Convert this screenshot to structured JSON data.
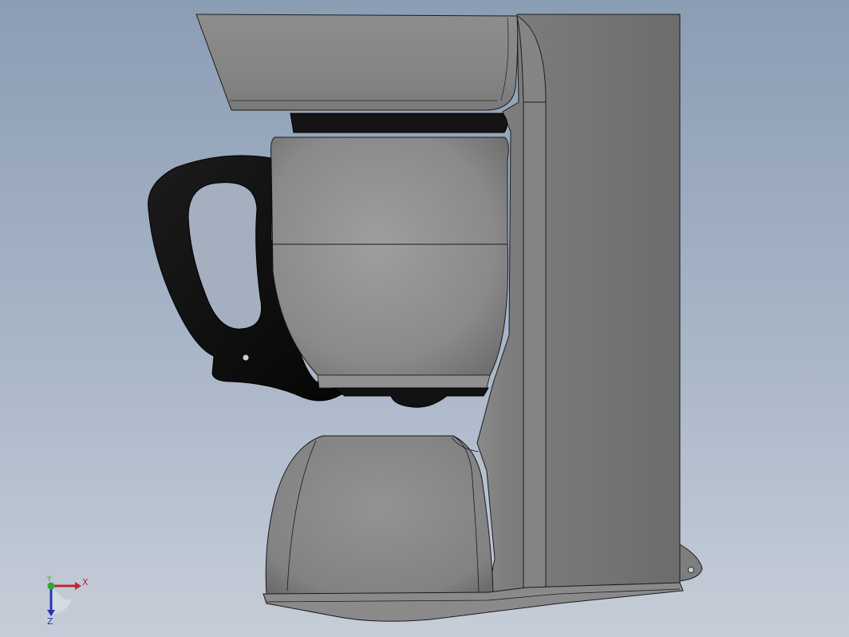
{
  "view": {
    "background_top": "#8b9db4",
    "background_bottom": "#c6cdd8"
  },
  "model": {
    "body_color": "#7c7c7c",
    "handle_color": "#0e0e0e",
    "edge_color": "#1a1a1a"
  },
  "triad": {
    "x_label": "X",
    "y_label": "Y",
    "z_label": "Z",
    "x_color": "#c0282c",
    "y_color": "#2fa83a",
    "z_color": "#2436b8"
  }
}
